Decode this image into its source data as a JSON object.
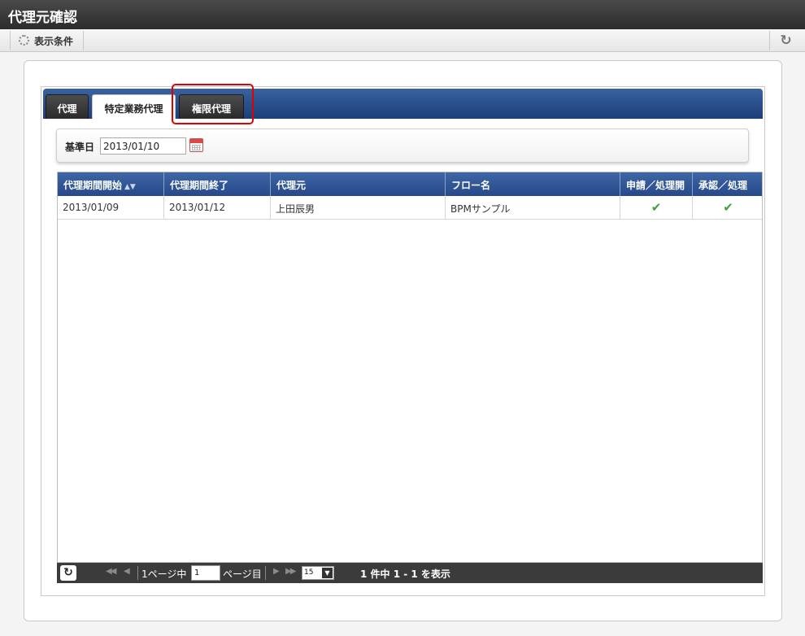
{
  "window": {
    "title": "代理元確認"
  },
  "toolbar": {
    "display_conditions_label": "表示条件",
    "refresh_icon": "refresh-icon"
  },
  "tabs": [
    {
      "label": "代理",
      "active": false
    },
    {
      "label": "特定業務代理",
      "active": true
    },
    {
      "label": "権限代理",
      "active": false,
      "highlighted": true
    }
  ],
  "filter": {
    "date_label": "基準日",
    "date_value": "2013/01/10",
    "calendar_icon": "calendar-icon"
  },
  "grid": {
    "columns": [
      "代理期間開始",
      "代理期間終了",
      "代理元",
      "フロー名",
      "申請／処理開",
      "承認／処理"
    ],
    "sort_indicator": "▲▼",
    "rows": [
      {
        "start": "2013/01/09",
        "end": "2013/01/12",
        "source": "上田辰男",
        "flow": "BPMサンプル",
        "apply": "✔",
        "approve": "✔"
      }
    ]
  },
  "pager": {
    "page_prefix": "1ページ中",
    "page_value": "1",
    "page_suffix": "ページ目",
    "page_size": "15",
    "status_text": "1 件中 1 - 1 を表示"
  },
  "colors": {
    "header_blue": "#2b4e8f",
    "highlight_red": "#e00000",
    "check_green": "#3aa335"
  }
}
